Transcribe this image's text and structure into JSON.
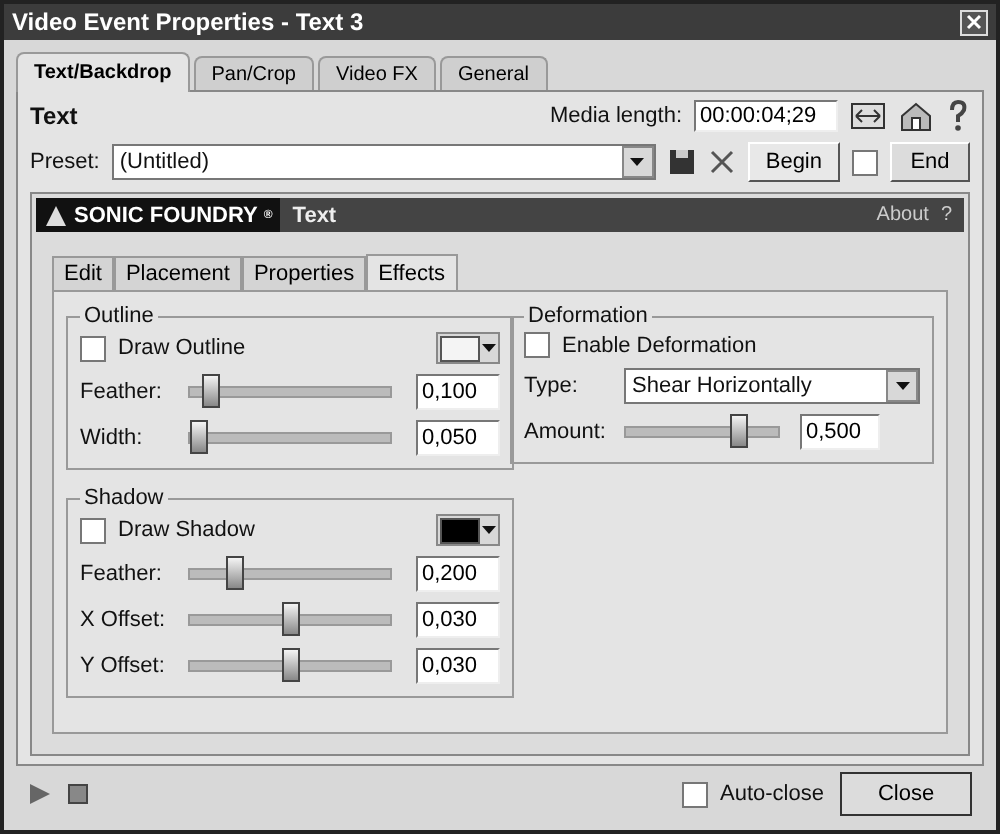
{
  "window": {
    "title": "Video Event Properties - Text 3"
  },
  "tabs": [
    {
      "label": "Text/Backdrop",
      "selected": true
    },
    {
      "label": "Pan/Crop",
      "selected": false
    },
    {
      "label": "Video FX",
      "selected": false
    },
    {
      "label": "General",
      "selected": false
    }
  ],
  "header": {
    "title": "Text",
    "media_length_label": "Media length:",
    "media_length": "00:00:04;29"
  },
  "preset": {
    "label": "Preset:",
    "value": "(Untitled)",
    "begin": "Begin",
    "end": "End",
    "keyframe_checked": false
  },
  "plugin": {
    "brand": "SONIC FOUNDRY",
    "brand_mark": "®",
    "name": "Text",
    "about": "About",
    "help": "?"
  },
  "inner_tabs": [
    {
      "label": "Edit",
      "selected": false
    },
    {
      "label": "Placement",
      "selected": false
    },
    {
      "label": "Properties",
      "selected": false
    },
    {
      "label": "Effects",
      "selected": true
    }
  ],
  "groups": [
    {
      "title": "Outline",
      "checkbox": {
        "label": "Draw Outline",
        "checked": false
      },
      "color": "#f4f4f4",
      "rows": [
        {
          "label": "Feather:",
          "level": 0.07,
          "value": "0,100"
        },
        {
          "label": "Width:",
          "level": 0.0,
          "value": "0,050"
        }
      ]
    },
    {
      "title": "Shadow",
      "checkbox": {
        "label": "Draw Shadow",
        "checked": false
      },
      "color": "#000000",
      "rows": [
        {
          "label": "Feather:",
          "level": 0.2,
          "value": "0,200"
        },
        {
          "label": "X Offset:",
          "level": 0.5,
          "value": "0,030"
        },
        {
          "label": "Y Offset:",
          "level": 0.5,
          "value": "0,030"
        }
      ]
    }
  ],
  "deformation": {
    "title": "Deformation",
    "checkbox": {
      "label": "Enable Deformation",
      "checked": false
    },
    "type_label": "Type:",
    "type_value": "Shear Horizontally",
    "amount": {
      "label": "Amount:",
      "level": 0.78,
      "value": "0,500"
    }
  },
  "footer": {
    "auto_close": {
      "label": "Auto-close",
      "checked": false
    },
    "close": "Close"
  }
}
